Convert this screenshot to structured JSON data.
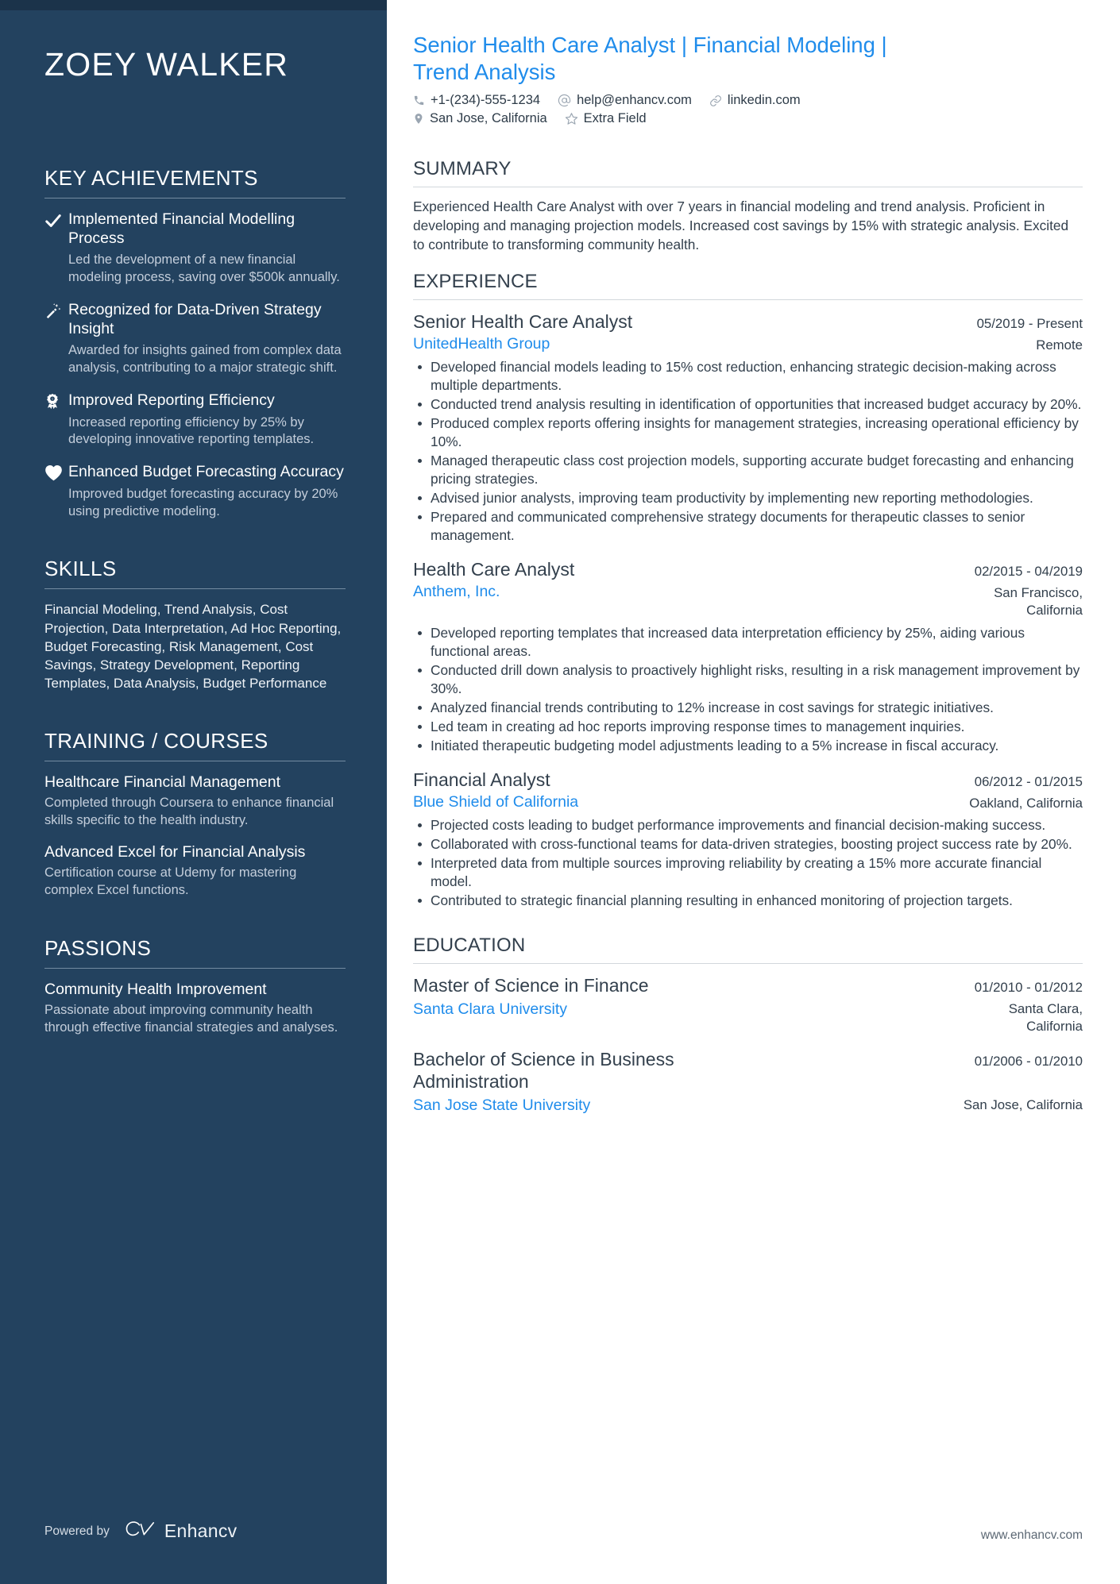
{
  "sidebar": {
    "name": "ZOEY WALKER",
    "achievements": {
      "heading": "KEY ACHIEVEMENTS",
      "items": [
        {
          "icon": "check-icon",
          "title": "Implemented Financial Modelling Process",
          "description": "Led the development of a new financial modeling process, saving over $500k annually."
        },
        {
          "icon": "magic-wand-icon",
          "title": "Recognized for Data-Driven Strategy Insight",
          "description": "Awarded for insights gained from complex data analysis, contributing to a major strategic shift."
        },
        {
          "icon": "award-ribbon-icon",
          "title": "Improved Reporting Efficiency",
          "description": "Increased reporting efficiency by 25% by developing innovative reporting templates."
        },
        {
          "icon": "heart-icon",
          "title": "Enhanced Budget Forecasting Accuracy",
          "description": "Improved budget forecasting accuracy by 20% using predictive modeling."
        }
      ]
    },
    "skills": {
      "heading": "SKILLS",
      "text": "Financial Modeling, Trend Analysis, Cost Projection, Data Interpretation, Ad Hoc Reporting, Budget Forecasting, Risk Management, Cost Savings, Strategy Development, Reporting Templates, Data Analysis, Budget Performance"
    },
    "training": {
      "heading": "TRAINING / COURSES",
      "items": [
        {
          "title": "Healthcare Financial Management",
          "description": "Completed through Coursera to enhance financial skills specific to the health industry."
        },
        {
          "title": "Advanced Excel for Financial Analysis",
          "description": "Certification course at Udemy for mastering complex Excel functions."
        }
      ]
    },
    "passions": {
      "heading": "PASSIONS",
      "items": [
        {
          "title": "Community Health Improvement",
          "description": "Passionate about improving community health through effective financial strategies and analyses."
        }
      ]
    },
    "powered_by": {
      "label": "Powered by",
      "brand": "Enhancv"
    }
  },
  "main": {
    "headline": "Senior Health Care Analyst | Financial Modeling | Trend Analysis",
    "contacts_row1": [
      {
        "icon": "phone-icon",
        "text": "+1-(234)-555-1234"
      },
      {
        "icon": "at-email-icon",
        "text": "help@enhancv.com"
      },
      {
        "icon": "link-icon",
        "text": "linkedin.com"
      }
    ],
    "contacts_row2": [
      {
        "icon": "map-pin-icon",
        "text": "San Jose, California"
      },
      {
        "icon": "star-icon",
        "text": "Extra Field"
      }
    ],
    "summary": {
      "heading": "SUMMARY",
      "text": "Experienced Health Care Analyst with over 7 years in financial modeling and trend analysis. Proficient in developing and managing projection models. Increased cost savings by 15% with strategic analysis. Excited to contribute to transforming community health."
    },
    "experience": {
      "heading": "EXPERIENCE",
      "jobs": [
        {
          "title": "Senior Health Care Analyst",
          "date": "05/2019 - Present",
          "company": "UnitedHealth Group",
          "location": "Remote",
          "bullets": [
            "Developed financial models leading to 15% cost reduction, enhancing strategic decision-making across multiple departments.",
            "Conducted trend analysis resulting in identification of opportunities that increased budget accuracy by 20%.",
            "Produced complex reports offering insights for management strategies, increasing operational efficiency by 10%.",
            "Managed therapeutic class cost projection models, supporting accurate budget forecasting and enhancing pricing strategies.",
            "Advised junior analysts, improving team productivity by implementing new reporting methodologies.",
            "Prepared and communicated comprehensive strategy documents for therapeutic classes to senior management."
          ]
        },
        {
          "title": "Health Care Analyst",
          "date": "02/2015 - 04/2019",
          "company": "Anthem, Inc.",
          "location": "San Francisco, California",
          "bullets": [
            "Developed reporting templates that increased data interpretation efficiency by 25%, aiding various functional areas.",
            "Conducted drill down analysis to proactively highlight risks, resulting in a risk management improvement by 30%.",
            "Analyzed financial trends contributing to 12% increase in cost savings for strategic initiatives.",
            "Led team in creating ad hoc reports improving response times to management inquiries.",
            "Initiated therapeutic budgeting model adjustments leading to a 5% increase in fiscal accuracy."
          ]
        },
        {
          "title": "Financial Analyst",
          "date": "06/2012 - 01/2015",
          "company": "Blue Shield of California",
          "location": "Oakland, California",
          "bullets": [
            "Projected costs leading to budget performance improvements and financial decision-making success.",
            "Collaborated with cross-functional teams for data-driven strategies, boosting project success rate by 20%.",
            "Interpreted data from multiple sources improving reliability by creating a 15% more accurate financial model.",
            "Contributed to strategic financial planning resulting in enhanced monitoring of projection targets."
          ]
        }
      ]
    },
    "education": {
      "heading": "EDUCATION",
      "items": [
        {
          "degree": "Master of Science in Finance",
          "date": "01/2010 - 01/2012",
          "school": "Santa Clara University",
          "location": "Santa Clara, California"
        },
        {
          "degree": "Bachelor of Science in Business Administration",
          "date": "01/2006 - 01/2010",
          "school": "San Jose State University",
          "location": "San Jose, California"
        }
      ]
    },
    "footer_url": "www.enhancv.com"
  },
  "colors": {
    "sidebar_bg": "#23425f",
    "sidebar_topbar": "#1b334a",
    "accent_blue": "#1f8ceb",
    "body_text": "#33404d"
  }
}
